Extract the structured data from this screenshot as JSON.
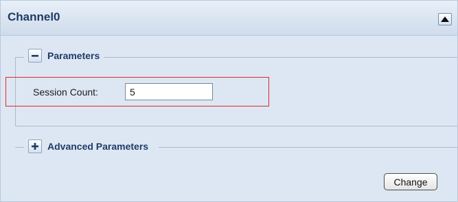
{
  "panel": {
    "title": "Channel0"
  },
  "parameters": {
    "legend": "Parameters",
    "toggle_icon": "minus-icon",
    "session_count_label": "Session Count:",
    "session_count_value": "5"
  },
  "advanced": {
    "legend": "Advanced Parameters",
    "toggle_icon": "plus-icon"
  },
  "actions": {
    "change_label": "Change"
  },
  "colors": {
    "title_text": "#1f3b66",
    "panel_bg": "#dde7f3",
    "highlight_border": "#e0262b"
  }
}
